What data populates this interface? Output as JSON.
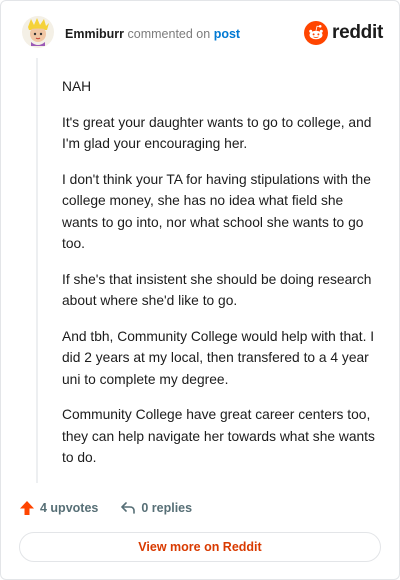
{
  "header": {
    "username": "Emmiburr",
    "verb": "commented on",
    "post_link": "post",
    "brand_name": "reddit",
    "avatar_icon": "cartoon-avatar-icon",
    "brand_icon": "reddit-snoo-icon"
  },
  "comment": {
    "paragraphs": [
      "NAH",
      "It's great your daughter wants to go to college, and I'm glad your encouraging her.",
      "I don't think your TA for having stipulations with the college money, she has no idea what field she wants to go into, nor what school she wants to go too.",
      "If she's that insistent she should be doing research about where she'd like to go.",
      "And tbh, Community College would help with that. I did 2 years at my local, then transfered to a 4 year uni to complete my degree.",
      "Community College have great career centers too, they can help navigate her towards what she wants to do."
    ]
  },
  "actions": {
    "upvotes_label": "4 upvotes",
    "replies_label": "0 replies",
    "upvote_icon": "upvote-arrow-icon",
    "reply_icon": "reply-arrow-icon"
  },
  "footer": {
    "view_more_label": "View more on Reddit"
  },
  "colors": {
    "accent": "#d93a00",
    "reddit_orange": "#ff4500",
    "link_blue": "#0079d3",
    "muted_text": "#576f76",
    "border": "#e3e5e8"
  }
}
